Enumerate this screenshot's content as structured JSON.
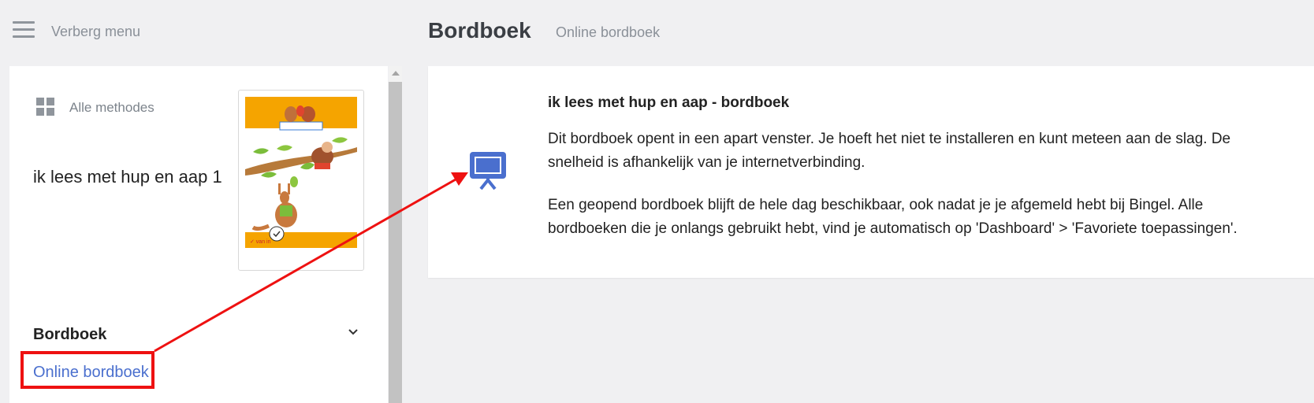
{
  "header": {
    "hide_menu_label": "Verberg menu",
    "page_title": "Bordboek",
    "breadcrumb": "Online bordboek"
  },
  "sidebar": {
    "all_methods_label": "Alle methodes",
    "method_title": "ik lees met hup en aap 1",
    "section_title": "Bordboek",
    "online_link": "Online bordboek"
  },
  "card": {
    "title": "ik lees met hup en aap - bordboek",
    "paragraph1": "Dit bordboek opent in een apart venster. Je hoeft het niet te installeren en kunt meteen aan de slag. De snelheid is afhankelijk van je internetverbinding.",
    "paragraph2": "Een geopend bordboek blijft de hele dag beschikbaar, ook nadat je je afgemeld hebt bij Bingel. Alle bordboeken die je onlangs gebruikt hebt, vind je automatisch op 'Dashboard' > 'Favoriete toepassingen'."
  },
  "icons": {
    "menu": "hamburger-menu-icon",
    "grid": "grid-icon",
    "chevron": "chevron-down-icon",
    "presentation": "presentation-board-icon"
  },
  "colors": {
    "accent": "#4a6fce",
    "highlight": "#ee1111",
    "cover_orange": "#f5a400"
  }
}
